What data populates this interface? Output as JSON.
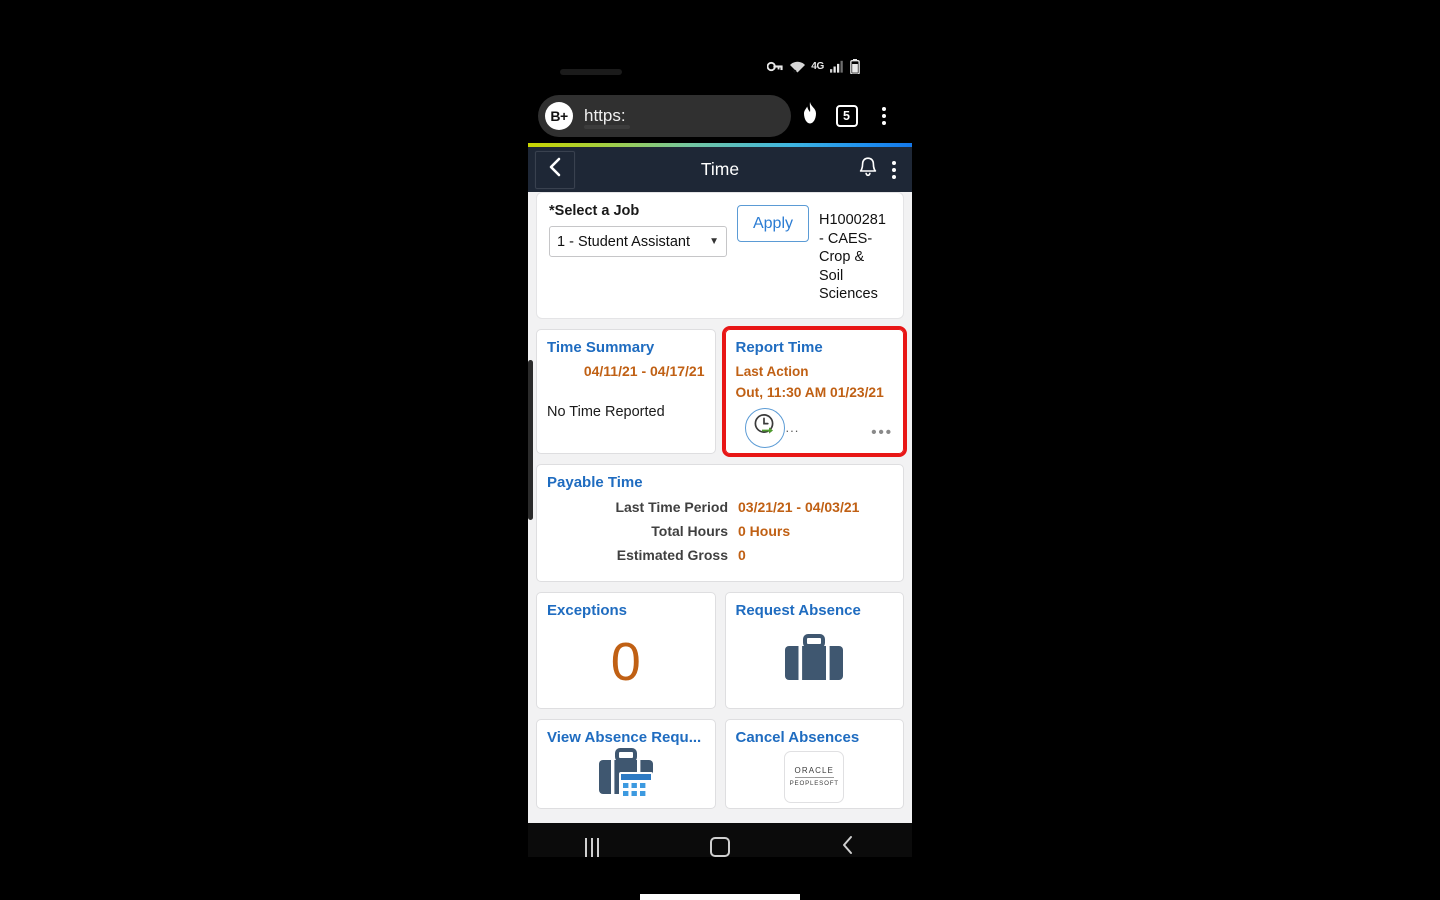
{
  "status_bar": {
    "icons": [
      "vpn-key-icon",
      "wifi-icon",
      "network-4g-icon",
      "signal-bars-icon",
      "battery-icon"
    ],
    "network_label": "4G"
  },
  "browser": {
    "shield_badge": "B+",
    "url": "https:",
    "brave_rewards_icon": "brave-flame-icon",
    "tab_count": "5",
    "menu_icon": "overflow-menu-icon"
  },
  "app_header": {
    "back_icon": "back-chevron-icon",
    "title": "Time",
    "notification_icon": "bell-icon",
    "menu_icon": "overflow-menu-icon"
  },
  "job_selector": {
    "label": "*Select a Job",
    "selected_value": "1 - Student Assistant",
    "apply_label": "Apply",
    "job_description": "H1000281 - CAES-Crop & Soil Sciences"
  },
  "tiles": {
    "time_summary": {
      "title": "Time Summary",
      "date_range": "04/11/21 - 04/17/21",
      "note": "No Time Reported"
    },
    "report_time": {
      "title": "Report Time",
      "last_action_label": "Last Action",
      "last_action_value": "Out, 11:30 AM 01/23/21",
      "clock_icon": "clock-punch-icon",
      "more_dots": "•••",
      "mini_dots": "...",
      "highlight_color": "#e81616"
    },
    "payable_time": {
      "title": "Payable Time",
      "rows": [
        {
          "label": "Last Time Period",
          "value": "03/21/21 - 04/03/21"
        },
        {
          "label": "Total Hours",
          "value": "0 Hours"
        },
        {
          "label": "Estimated Gross",
          "value": "0"
        }
      ]
    },
    "exceptions": {
      "title": "Exceptions",
      "count": "0"
    },
    "request_absence": {
      "title": "Request Absence",
      "icon": "briefcase-icon"
    },
    "view_absence_requests": {
      "title": "View Absence Requ...",
      "icon": "briefcase-calendar-icon"
    },
    "cancel_absences": {
      "title": "Cancel Absences",
      "logo_primary": "ORACLE",
      "logo_secondary": "PEOPLESOFT"
    }
  },
  "nav_bar": {
    "recents_label": "recents-icon",
    "home_label": "home-icon",
    "back_label": "back-icon"
  },
  "colors": {
    "header_bg": "#1e2736",
    "tile_title_blue": "#1f6cc0",
    "value_orange": "#c06014",
    "highlight_red": "#e81616",
    "page_bg": "#f2f2f3"
  }
}
